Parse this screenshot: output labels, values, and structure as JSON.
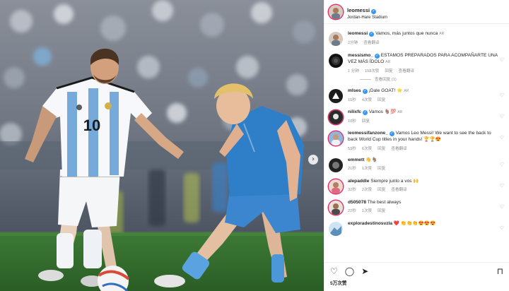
{
  "post": {
    "username": "leomessi",
    "location": "Jordan-Hare Stadium",
    "caption": {
      "username": "leomessi",
      "text": "Vamos, más juntos que nunca",
      "tag": "AR",
      "time": "2分钟",
      "view_translation": "查看翻译"
    }
  },
  "comments": [
    {
      "username": "messismo_",
      "text": "ESTAMOS PREPARADOS PARA ACOMPAÑARTE UNA VEZ MÁS ÍDOLO",
      "tag": "AR",
      "time": "1 分钟",
      "likes": "193次赞",
      "reply": "回复",
      "translate": "查看翻译",
      "view_replies": "查看回复 (1)"
    },
    {
      "username": "mlses",
      "text": "¡Dale GOAT! ⭐",
      "tag": "AR",
      "time": "15秒",
      "likes": "4次赞",
      "reply": "回复"
    },
    {
      "username": "nilixfc",
      "text": "Vamos 🐐💯",
      "tag": "AR",
      "time": "10秒",
      "reply": "回复"
    },
    {
      "username": "leomessifanzone_",
      "text": "Vamos Leo Messi! We want to see the back to back World Cup titles in your hands! 🏆🏆😍",
      "time": "53秒",
      "likes": "6次赞",
      "reply": "回复",
      "translate": "查看翻译"
    },
    {
      "username": "emmett",
      "text": "👋🐐",
      "time": "21秒",
      "likes": "1次赞",
      "reply": "回复"
    },
    {
      "username": "alepaddle",
      "text": "Siempre junto a vos 🙌",
      "time": "32秒",
      "likes": "2次赞",
      "reply": "回复",
      "translate": "查看翻译"
    },
    {
      "username": "d505078",
      "text": "The best always",
      "time": "22秒",
      "likes": "1次赞",
      "reply": "回复"
    },
    {
      "username": "exploradestinosvzla",
      "text": "❤️ 👏👏👏😍😍😍"
    }
  ],
  "actions": {
    "likes_count": "5万次赞"
  },
  "icons": {
    "like": "heart-outline-icon",
    "comment": "comment-bubble-icon",
    "share": "paper-plane-icon",
    "save": "bookmark-icon",
    "verified": "verified-badge-icon",
    "carousel_next": "chevron-right-icon"
  },
  "colors": {
    "verified": "#3897f0",
    "argentina_stripe": "#75aadb",
    "pitch": "#2f6a2c",
    "opponent_kit": "#2f7fc8"
  }
}
